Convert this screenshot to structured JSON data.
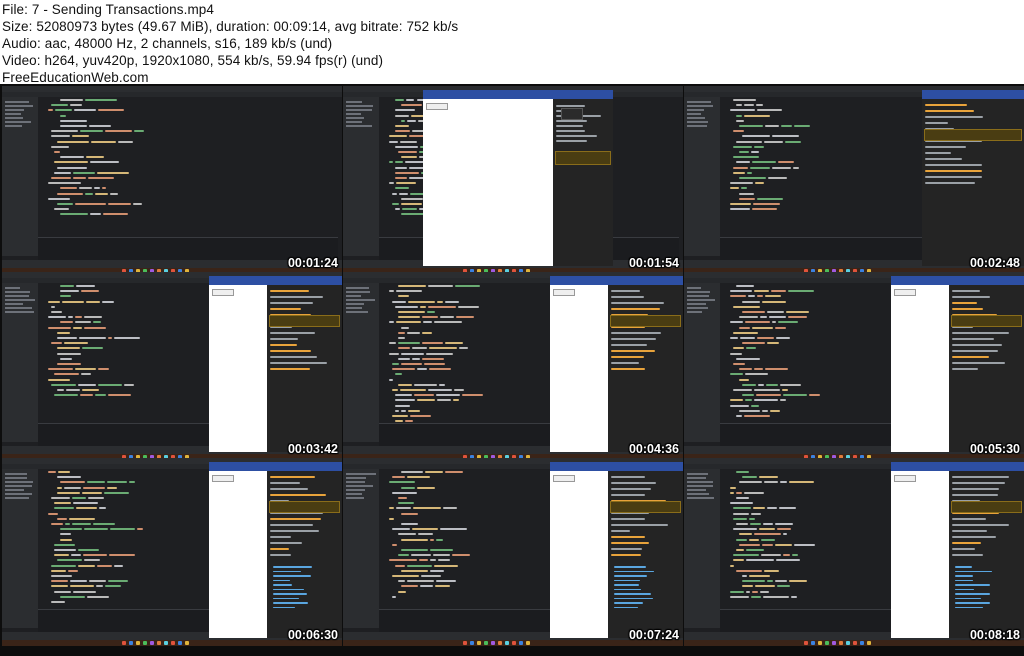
{
  "header": {
    "lines": [
      "File: 7 - Sending Transactions.mp4",
      "Size: 52080973 bytes (49.67 MiB), duration: 00:09:14, avg bitrate: 752 kb/s",
      "Audio: aac, 48000 Hz, 2 channels, s16, 189 kb/s (und)",
      "Video: h264, yuv420p, 1920x1080, 554 kb/s, 59.94 fps(r) (und)",
      "FreeEducationWeb.com"
    ]
  },
  "thumbnails": [
    {
      "timestamp": "00:01:24",
      "variant": "editor"
    },
    {
      "timestamp": "00:01:54",
      "variant": "popup"
    },
    {
      "timestamp": "00:02:48",
      "variant": "wide"
    },
    {
      "timestamp": "00:03:42",
      "variant": "split"
    },
    {
      "timestamp": "00:04:36",
      "variant": "split"
    },
    {
      "timestamp": "00:05:30",
      "variant": "split"
    },
    {
      "timestamp": "00:06:30",
      "variant": "split"
    },
    {
      "timestamp": "00:07:24",
      "variant": "split"
    },
    {
      "timestamp": "00:08:18",
      "variant": "split"
    }
  ],
  "colors": {
    "background": "#0d0d0d",
    "editor": "#1e1f22",
    "sidebar": "#2b2d30",
    "taskbar": "#3a2418",
    "browser_chrome": "#2d4fa3",
    "tag": "#d5b778",
    "keyword": "#cf8e6d",
    "string": "#6aab73",
    "plain": "#bcbec4",
    "attr": "#bababa"
  }
}
